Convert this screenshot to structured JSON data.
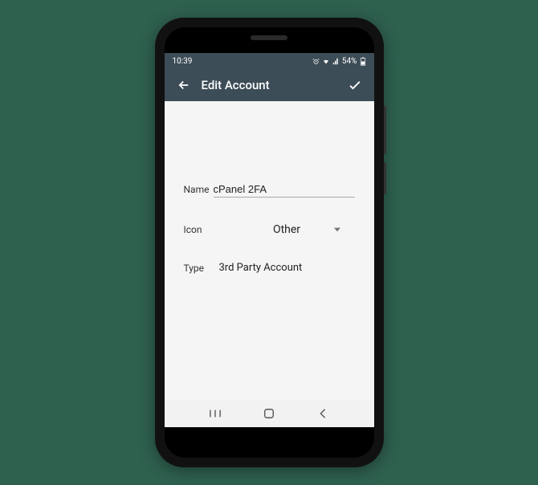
{
  "status": {
    "time": "10:39",
    "battery_pct": "54%"
  },
  "appbar": {
    "title": "Edit Account"
  },
  "form": {
    "name_label": "Name",
    "name_value": "cPanel 2FA",
    "icon_label": "Icon",
    "icon_value": "Other",
    "type_label": "Type",
    "type_value": "3rd Party Account"
  }
}
